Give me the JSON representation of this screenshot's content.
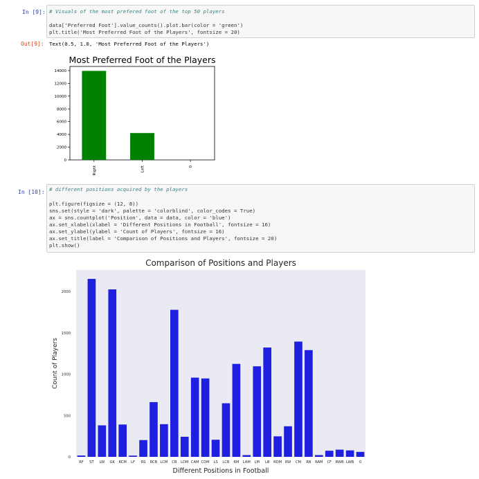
{
  "cell9": {
    "in_prompt": "In [9]:",
    "out_prompt": "Out[9]:",
    "code_comment": "# Visuals of the most prefered foot of the top 50 players",
    "code_line2": "data['Preferred Foot'].value_counts().plot.bar(color = 'green')",
    "code_line3": "plt.title('Most Preferred Foot of the Players', fontsize = 20)",
    "output_text": "Text(0.5, 1.0, 'Most Preferred Foot of the Players')"
  },
  "cell10": {
    "in_prompt": "In [10]:",
    "code_comment": "# different positions acquired by the players",
    "code_lines": [
      "plt.figure(figsize = (12, 8))",
      "sns.set(style = 'dark', palette = 'colorblind', color_codes = True)",
      "ax = sns.countplot('Position', data = data, color = 'blue')",
      "ax.set_xlabel(xlabel = 'Different Positions in Football', fontsize = 16)",
      "ax.set_ylabel(ylabel = 'Count of Players', fontsize = 16)",
      "ax.set_title(label = 'Comparison of Positions and Players', fontsize = 20)",
      "plt.show()"
    ]
  },
  "colors": {
    "green": "#008000",
    "blue": "#1f1fe0",
    "seaborn_bg": "#eaeaf2"
  },
  "chart_data": [
    {
      "type": "bar",
      "title": "Most Preferred Foot of the Players",
      "xlabel": "",
      "ylabel": "",
      "categories": [
        "Right",
        "Left",
        "0"
      ],
      "values": [
        13948,
        4211,
        0
      ],
      "yticks": [
        0,
        2000,
        4000,
        6000,
        8000,
        10000,
        12000,
        14000
      ],
      "ylim": [
        0,
        14646
      ],
      "color": "#008000",
      "grid": false
    },
    {
      "type": "bar",
      "title": "Comparison of Positions and Players",
      "xlabel": "Different Positions in Football",
      "ylabel": "Count of Players",
      "categories": [
        "RF",
        "ST",
        "LW",
        "GK",
        "RCM",
        "LF",
        "RS",
        "RCB",
        "LCM",
        "CB",
        "LDM",
        "CAM",
        "CDM",
        "LS",
        "LCB",
        "RM",
        "LAM",
        "LM",
        "LB",
        "RDM",
        "RW",
        "CM",
        "RB",
        "RAM",
        "CF",
        "RWB",
        "LWB",
        "0"
      ],
      "values": [
        16,
        2152,
        381,
        2025,
        391,
        15,
        203,
        662,
        395,
        1778,
        243,
        958,
        948,
        207,
        648,
        1124,
        21,
        1095,
        1322,
        248,
        370,
        1394,
        1291,
        21,
        74,
        87,
        78,
        60
      ],
      "yticks": [
        0,
        500,
        1000,
        1500,
        2000
      ],
      "ylim": [
        0,
        2260
      ],
      "color": "#1f1fe0",
      "grid": false
    }
  ]
}
